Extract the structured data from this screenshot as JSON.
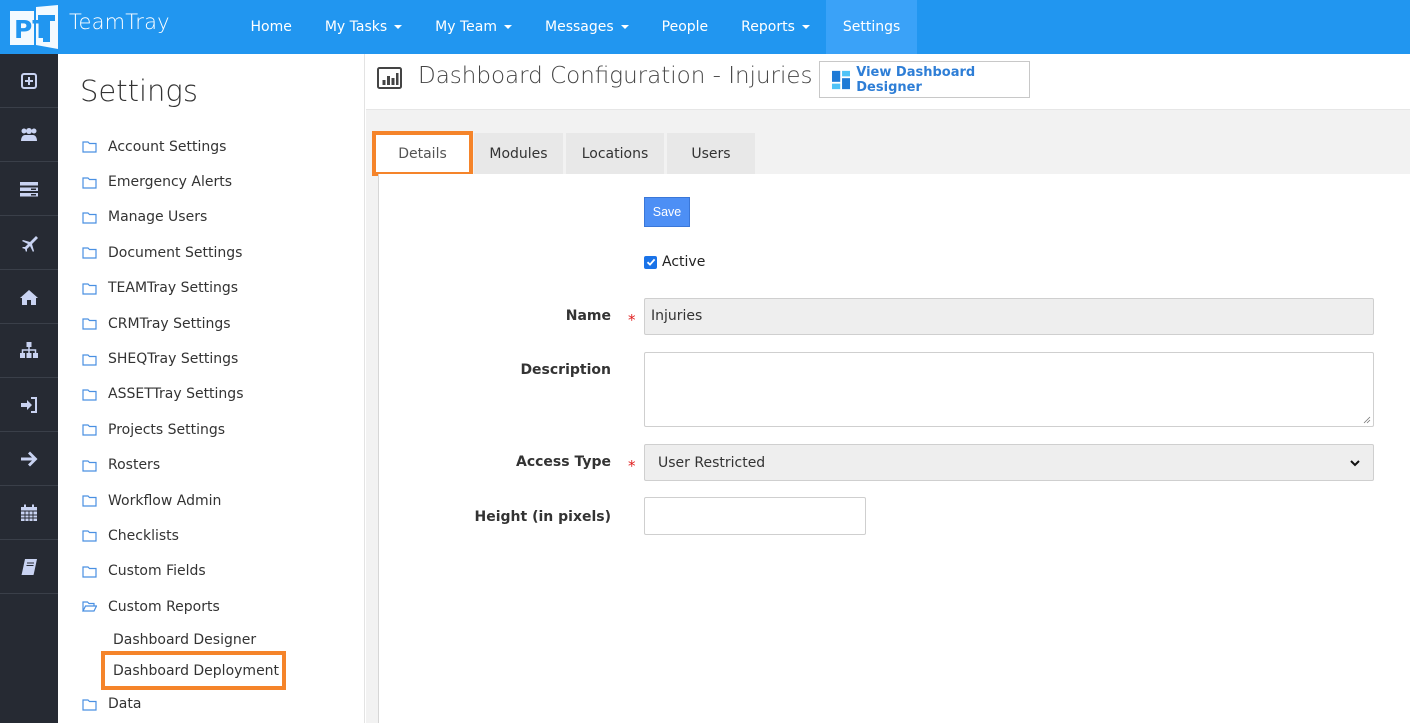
{
  "app": {
    "brand": "TeamTray",
    "logo_text": "PT"
  },
  "topnav": {
    "items": [
      {
        "label": "Home",
        "dropdown": false,
        "active": false
      },
      {
        "label": "My Tasks",
        "dropdown": true,
        "active": false
      },
      {
        "label": "My Team",
        "dropdown": true,
        "active": false
      },
      {
        "label": "Messages",
        "dropdown": true,
        "active": false
      },
      {
        "label": "People",
        "dropdown": false,
        "active": false
      },
      {
        "label": "Reports",
        "dropdown": true,
        "active": false
      },
      {
        "label": "Settings",
        "dropdown": false,
        "active": true
      }
    ]
  },
  "rail": {
    "icons": [
      "plus-square-icon",
      "users-icon",
      "server-icon",
      "plane-icon",
      "home-icon",
      "sitemap-icon",
      "sign-in-icon",
      "arrow-right-icon",
      "calendar-icon",
      "book-icon"
    ]
  },
  "settings_nav": {
    "title": "Settings",
    "items": [
      {
        "label": "Account Settings"
      },
      {
        "label": "Emergency Alerts"
      },
      {
        "label": "Manage Users"
      },
      {
        "label": "Document Settings"
      },
      {
        "label": "TEAMTray Settings"
      },
      {
        "label": "CRMTray Settings"
      },
      {
        "label": "SHEQTray Settings"
      },
      {
        "label": "ASSETTray Settings"
      },
      {
        "label": "Projects Settings"
      },
      {
        "label": "Rosters"
      },
      {
        "label": "Workflow Admin"
      },
      {
        "label": "Checklists"
      },
      {
        "label": "Custom Fields"
      },
      {
        "label": "Custom Reports",
        "open": true,
        "children": [
          {
            "label": "Dashboard Designer"
          },
          {
            "label": "Dashboard Deployment",
            "highlighted": true
          }
        ]
      },
      {
        "label": "Data"
      }
    ]
  },
  "page": {
    "title": "Dashboard Configuration - Injuries",
    "designer_button": "View Dashboard Designer",
    "tabs": [
      {
        "label": "Details",
        "active": true
      },
      {
        "label": "Modules",
        "active": false
      },
      {
        "label": "Locations",
        "active": false
      },
      {
        "label": "Users",
        "active": false
      }
    ]
  },
  "form": {
    "save_label": "Save",
    "active_label": "Active",
    "active_checked": true,
    "name_label": "Name",
    "name_value": "Injuries",
    "description_label": "Description",
    "description_value": "",
    "access_type_label": "Access Type",
    "access_type_value": "User Restricted",
    "height_label": "Height (in pixels)",
    "height_value": "",
    "required_marker": "*"
  },
  "colors": {
    "topbar": "#2196f0",
    "rail": "#262a33",
    "accent_link": "#2e7ed6",
    "highlight": "#f5842a",
    "save_button": "#4d8ff5"
  }
}
